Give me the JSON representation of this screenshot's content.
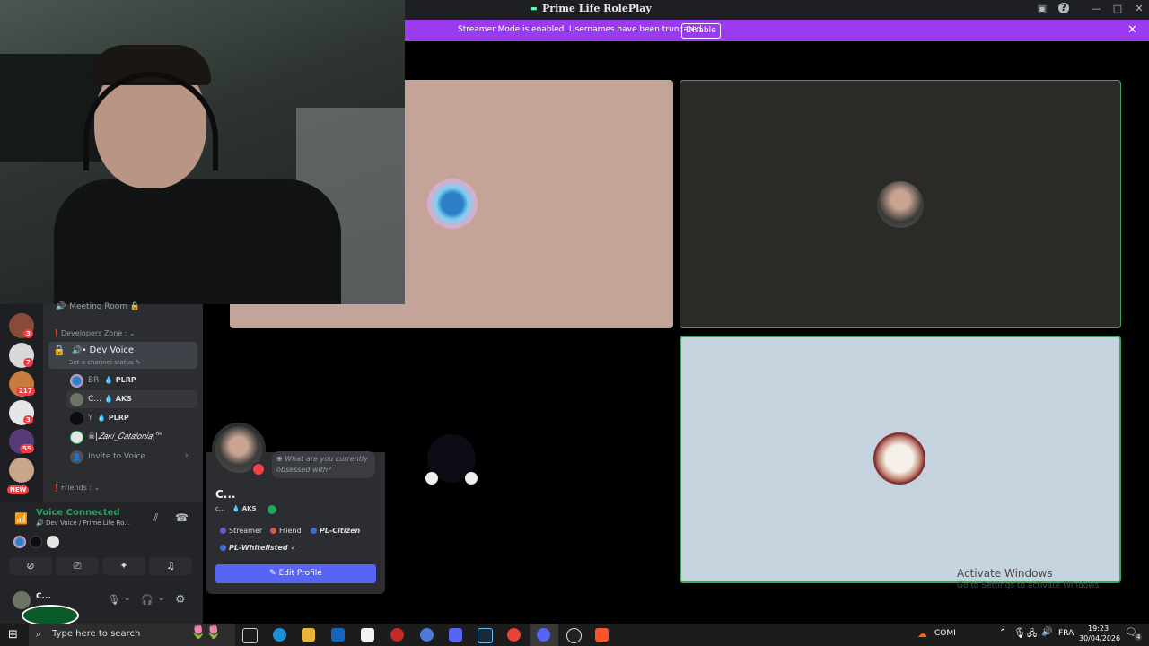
{
  "window": {
    "title": "Prime Life RolePlay"
  },
  "banner": {
    "text": "Streamer Mode is enabled. Usernames have been truncated.",
    "button": "Disable"
  },
  "channels": {
    "top_channel": "Meeting Room 🔒",
    "category": "Developers Zone :",
    "voice_channel": "Dev Voice",
    "status_hint": "Set a channel status",
    "members": [
      {
        "name": "BR",
        "tag": "PLRP"
      },
      {
        "name": "C...",
        "tag": "AKS"
      },
      {
        "name": "Y",
        "tag": "PLRP"
      },
      {
        "name": "☠|𝑍𝑎𝑘𝑖_𝐶𝑎𝑡𝑎𝑙𝑜𝑛𝑖𝑎|™",
        "tag": ""
      }
    ],
    "invite": "Invite to Voice",
    "friends_category": "Friends :"
  },
  "servers": [
    {
      "badge": "3"
    },
    {
      "badge": "7"
    },
    {
      "badge": "217"
    },
    {
      "badge": "3"
    },
    {
      "badge": "55"
    },
    {
      "badge": "NEW"
    }
  ],
  "voice": {
    "status": "Voice Connected",
    "location": "Dev Voice / Prime Life Ro..."
  },
  "user": {
    "name": "C..."
  },
  "profile": {
    "name": "C...",
    "sub": "c...",
    "tag": "AKS",
    "status_placeholder": "What are you currently obsessed with?",
    "roles": [
      {
        "label": "Streamer",
        "color": "#7b4fd6"
      },
      {
        "label": "Friend",
        "color": "#e0553f"
      },
      {
        "label": "PL-Citizen",
        "color": "#3b6fd6"
      },
      {
        "label": "PL-Whitelisted",
        "color": "#3b6fd6"
      }
    ],
    "edit_button": "Edit Profile"
  },
  "taskbar": {
    "search_placeholder": "Type here to search",
    "weather": "COMI",
    "lang": "FRA",
    "time": "19:23",
    "date": "30/04/2026",
    "notif_count": "4"
  },
  "watermark": {
    "line1": "Activate Windows",
    "line2": "Go to Settings to activate Windows."
  },
  "colors": {
    "accent": "#5865f2",
    "streamer_banner": "#9b3bf0",
    "speaking": "#3ba55c",
    "voice_connected": "#23a55a"
  }
}
